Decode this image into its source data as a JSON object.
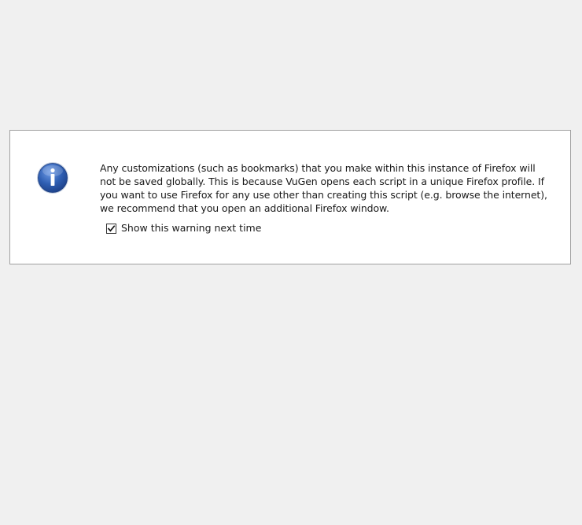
{
  "dialog": {
    "icon": "info-icon",
    "message": "Any customizations (such as bookmarks) that you make within this instance of Firefox will not be saved globally. This is because VuGen opens each script in a unique Firefox profile. If you want to use Firefox for any use other than creating this script (e.g. browse the internet), we recommend that you open an additional Firefox window.",
    "checkbox": {
      "label": "Show this warning next time",
      "checked": true
    }
  },
  "colors": {
    "background": "#f0f0f0",
    "panel": "#ffffff",
    "panel_border": "#a0a0a0",
    "icon_blue": "#2f5fb3",
    "text": "#1a1a1a"
  }
}
